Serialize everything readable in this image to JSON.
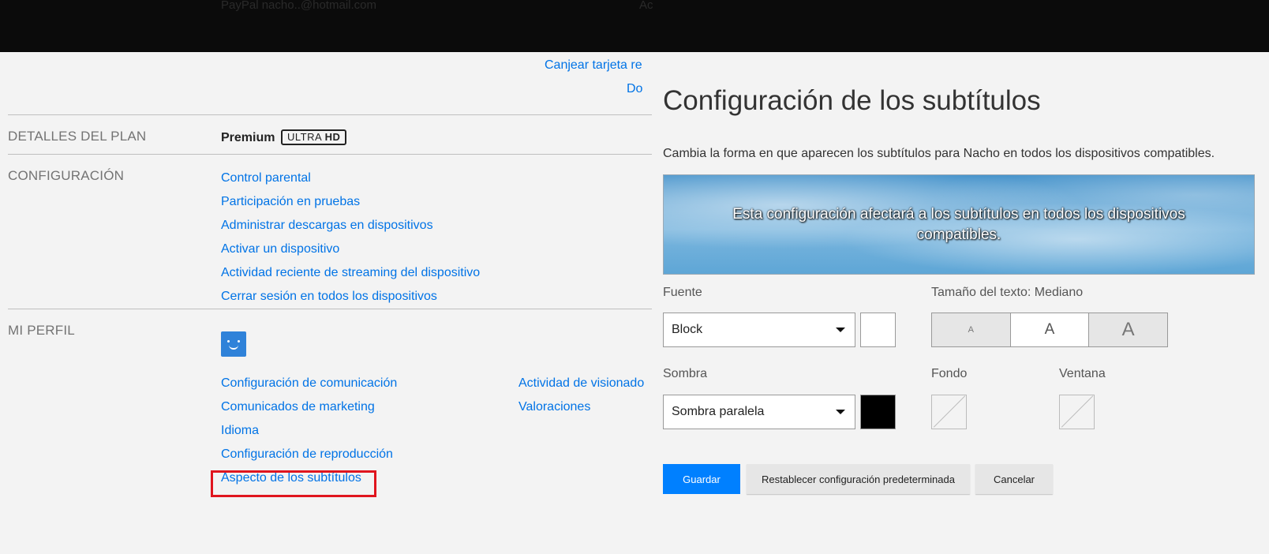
{
  "topbar": {
    "payment_text": "PayPal  nacho..@hotmail.com",
    "payment_right": "Ac"
  },
  "account": {
    "redeem_link": "Canjear tarjeta re",
    "second_link": "Do",
    "plan": {
      "label": "DETALLES DEL PLAN",
      "name": "Premium",
      "badge_prefix": "ULTRA",
      "badge_suffix": "HD"
    },
    "settings": {
      "label": "CONFIGURACIÓN",
      "links": [
        "Control parental",
        "Participación en pruebas",
        "Administrar descargas en dispositivos",
        "Activar un dispositivo",
        "Actividad reciente de streaming del dispositivo",
        "Cerrar sesión en todos los dispositivos"
      ]
    },
    "profile": {
      "label": "MI PERFIL",
      "links_left": [
        "Configuración de comunicación",
        "Comunicados de marketing",
        "Idioma",
        "Configuración de reproducción",
        "Aspecto de los subtítulos"
      ],
      "links_right": [
        "Actividad de visionado",
        "Valoraciones"
      ]
    }
  },
  "subtitles": {
    "title": "Configuración de los subtítulos",
    "description": "Cambia la forma en que aparecen los subtítulos para Nacho en todos los dispositivos compatibles.",
    "preview_text": "Esta configuración afectará a los subtítulos en todos los dispositivos compatibles.",
    "font": {
      "label": "Fuente",
      "value": "Block",
      "color": "#ffffff"
    },
    "text_size": {
      "label": "Tamaño del texto: Mediano",
      "options": [
        "A",
        "A",
        "A"
      ],
      "selected": "Mediano"
    },
    "shadow": {
      "label": "Sombra",
      "value": "Sombra paralela",
      "color": "#000000"
    },
    "background": {
      "label": "Fondo"
    },
    "window": {
      "label": "Ventana"
    },
    "buttons": {
      "save": "Guardar",
      "reset": "Restablecer configuración predeterminada",
      "cancel": "Cancelar"
    }
  },
  "colors": {
    "link": "#0073e6",
    "primary_button": "#0080ff",
    "highlight": "#e0151e"
  }
}
